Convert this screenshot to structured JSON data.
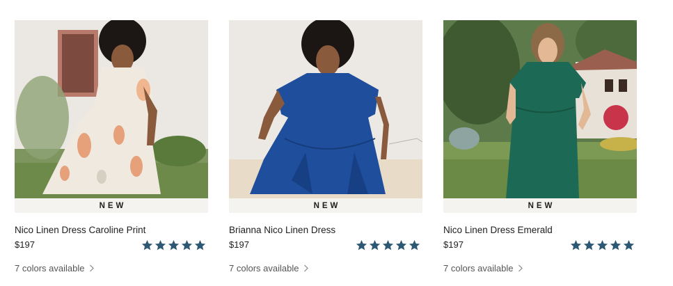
{
  "colors": {
    "star": "#2d5873",
    "badge_bg": "#f4f3ef"
  },
  "products": [
    {
      "badge": "NEW",
      "title": "Nico Linen Dress Caroline Print",
      "price": "$197",
      "rating": 5,
      "rating_max": 5,
      "colors_text": "7 colors available",
      "chevron_icon": "chevron-right-icon"
    },
    {
      "badge": "NEW",
      "title": "Brianna Nico Linen Dress",
      "price": "$197",
      "rating": 5,
      "rating_max": 5,
      "colors_text": "7 colors available",
      "chevron_icon": "chevron-right-icon"
    },
    {
      "badge": "NEW",
      "title": "Nico Linen Dress Emerald",
      "price": "$197",
      "rating": 5,
      "rating_max": 5,
      "colors_text": "7 colors available",
      "chevron_icon": "chevron-right-icon"
    }
  ]
}
